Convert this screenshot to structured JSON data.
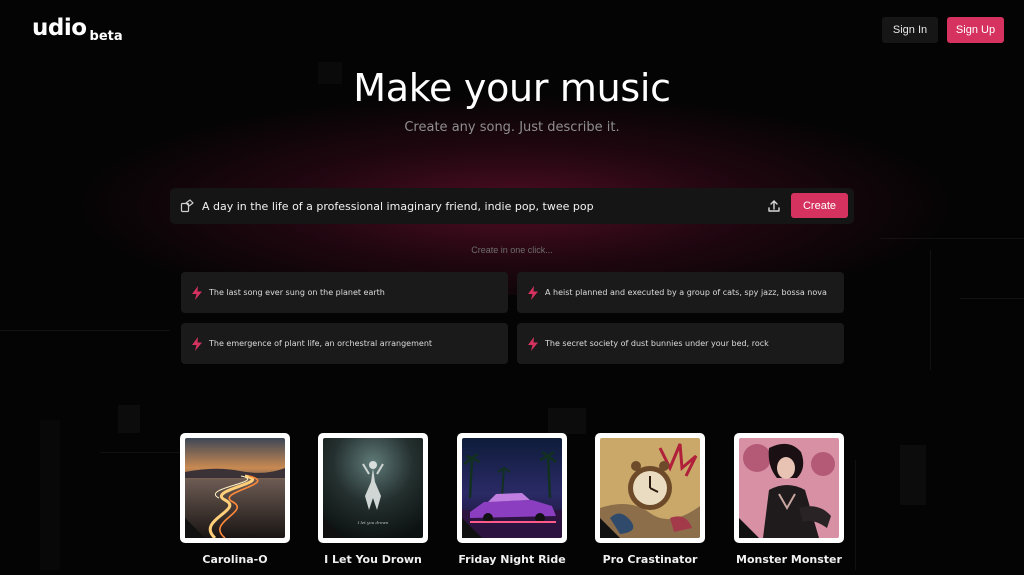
{
  "brand": {
    "name": "udio",
    "tag": "beta"
  },
  "header": {
    "sign_in": "Sign In",
    "sign_up": "Sign Up"
  },
  "hero": {
    "title": "Make your music",
    "subtitle": "Create any song. Just describe it."
  },
  "prompt": {
    "value": "A day in the life of a professional imaginary friend, indie pop, twee pop",
    "create_label": "Create",
    "shuffle_icon": "shuffle-icon",
    "upload_icon": "upload-icon"
  },
  "one_click_label": "Create in one click...",
  "suggestions": [
    {
      "text": "The last song ever sung on the planet earth",
      "icon": "lightning-icon"
    },
    {
      "text": "A heist planned and executed by a group of cats, spy jazz, bossa nova",
      "icon": "lightning-icon"
    },
    {
      "text": "The emergence of plant life, an orchestral arrangement",
      "icon": "lightning-icon"
    },
    {
      "text": "The secret society of dust bunnies under your bed, rock",
      "icon": "lightning-icon"
    }
  ],
  "songs": [
    {
      "title": "Carolina-O"
    },
    {
      "title": "I Let You Drown",
      "cover_text": "I let you drown"
    },
    {
      "title": "Friday Night Ride"
    },
    {
      "title": "Pro Crastinator"
    },
    {
      "title": "Monster Monster"
    }
  ],
  "colors": {
    "accent": "#d6325f",
    "background": "#040404",
    "card": "#1a1a1a"
  }
}
